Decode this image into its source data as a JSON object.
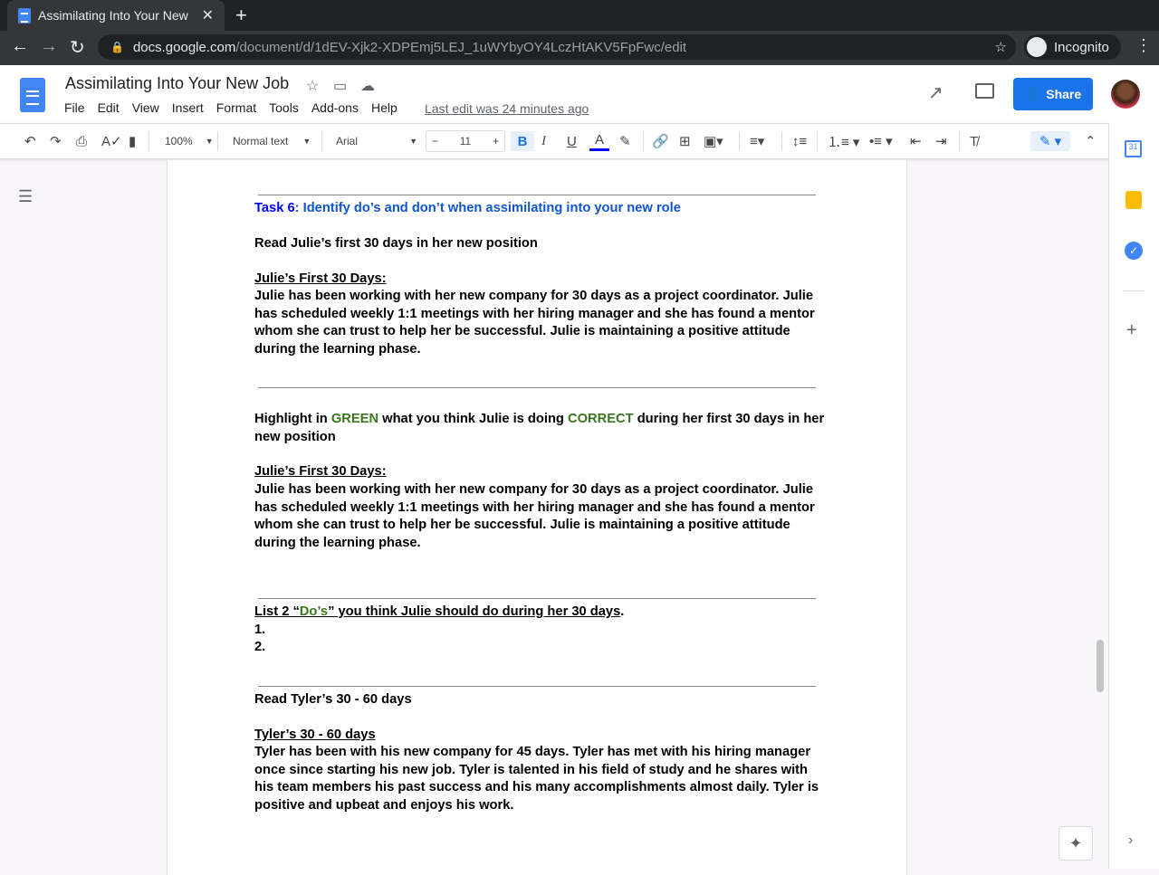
{
  "browser": {
    "tab_title": "Assimilating Into Your New",
    "url_host": "docs.google.com",
    "url_path": "/document/d/1dEV-Xjk2-XDPEmj5LEJ_1uWYbyOY4LczHtAKV5FpFwc/edit",
    "profile": "Incognito"
  },
  "doc": {
    "title": "Assimilating Into Your New Job",
    "menu": [
      "File",
      "Edit",
      "View",
      "Insert",
      "Format",
      "Tools",
      "Add-ons",
      "Help"
    ],
    "last_edit": "Last edit was 24 minutes ago",
    "share": "Share"
  },
  "toolbar": {
    "zoom": "100%",
    "style": "Normal text",
    "font": "Arial",
    "size": "11",
    "bold": "B",
    "italic": "I",
    "underline": "U",
    "text_color": "A"
  },
  "content": {
    "task_label": "Task 6",
    "task_rest": ": Identify do’s and don’t when assimilating into your new role",
    "read1": "Read Julie’s first 30 days in her new position",
    "julie_heading": "Julie’s First 30 Days:",
    "julie_text": "Julie has been working with her new company for 30 days as a project coordinator. Julie has scheduled weekly 1:1 meetings with her hiring manager and she has found a mentor whom she can trust to help her be successful. Julie is maintaining a positive attitude during the learning phase.",
    "hl_1": "Highlight in ",
    "hl_green": "GREEN",
    "hl_2": " what  you think Julie is doing ",
    "hl_correct": "CORRECT",
    "hl_3": " during her first 30 days in her new position",
    "list_1": "List  2 “",
    "list_dos": "Do’s",
    "list_2": "” you think Julie should do during her 30 days",
    "list_period": ".",
    "item1": "1.",
    "item2": "2.",
    "read2": "Read Tyler’s 30 - 60 days",
    "tyler_heading": "Tyler’s 30 - 60 days",
    "tyler_text": "Tyler has been with his new company for 45 days. Tyler has met with his hiring manager once since starting his new job. Tyler is talented in his field of study and he shares with his team members his past success and his many accomplishments almost daily. Tyler is positive and upbeat and enjoys his work."
  },
  "colors": {
    "task_blue": "#1155cc",
    "green": "#38761d",
    "share": "#1a73e8"
  }
}
